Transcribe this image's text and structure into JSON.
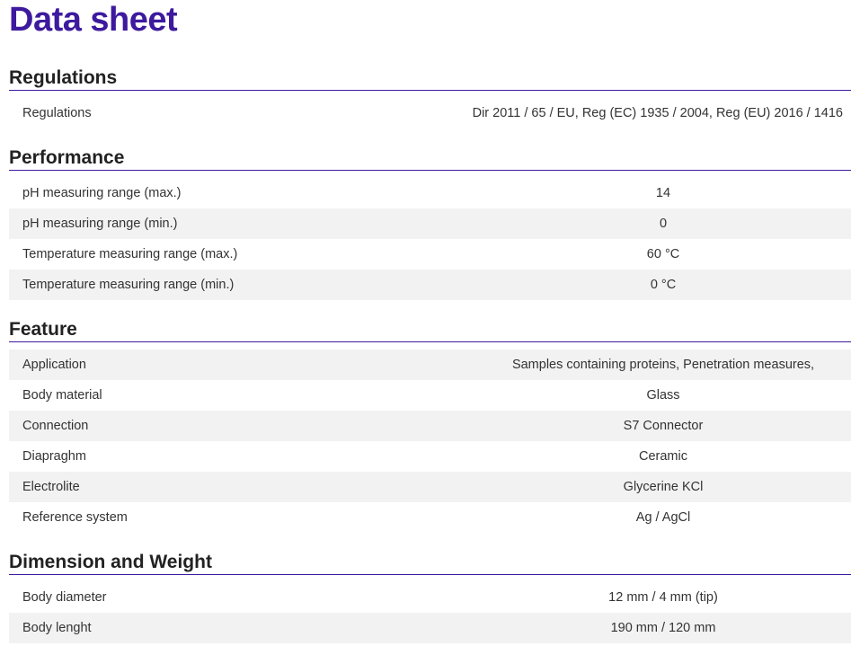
{
  "page_title": "Data sheet",
  "sections": [
    {
      "heading": "Regulations",
      "rows": [
        {
          "label": "Regulations",
          "value": "Dir 2011 / 65 / EU, Reg (EC) 1935 / 2004, Reg (EU) 2016 / 1416"
        }
      ]
    },
    {
      "heading": "Performance",
      "rows": [
        {
          "label": "pH measuring range (max.)",
          "value": "14"
        },
        {
          "label": "pH measuring range (min.)",
          "value": "0"
        },
        {
          "label": "Temperature measuring range (max.)",
          "value": "60 °C"
        },
        {
          "label": "Temperature measuring range (min.)",
          "value": "0 °C"
        }
      ]
    },
    {
      "heading": "Feature",
      "rows": [
        {
          "label": "Application",
          "value": "Samples containing proteins, Penetration measures,"
        },
        {
          "label": "Body material",
          "value": "Glass"
        },
        {
          "label": "Connection",
          "value": "S7 Connector"
        },
        {
          "label": "Diapraghm",
          "value": "Ceramic"
        },
        {
          "label": "Electrolite",
          "value": "Glycerine KCl"
        },
        {
          "label": "Reference system",
          "value": "Ag / AgCl"
        }
      ]
    },
    {
      "heading": "Dimension and Weight",
      "rows": [
        {
          "label": "Body diameter",
          "value": "12 mm / 4 mm (tip)"
        },
        {
          "label": "Body lenght",
          "value": "190 mm / 120 mm"
        }
      ]
    }
  ]
}
